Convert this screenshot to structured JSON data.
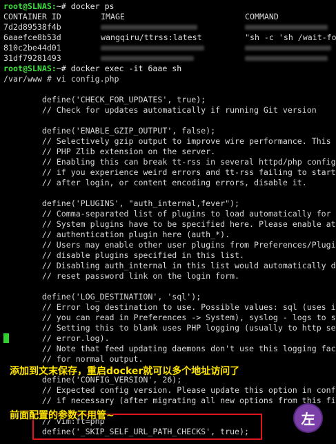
{
  "ps": {
    "prompt": "root@SLNAS:",
    "command": "~# docker ps",
    "headers": {
      "id": "CONTAINER ID",
      "image": "IMAGE",
      "cmd": "COMMAND"
    },
    "rows": [
      {
        "id": "7d2d89538f4b",
        "image": "",
        "cmd": ""
      },
      {
        "id": "6aaefce8b53d",
        "image": "wangqiru/ttrss:latest",
        "cmd": "\"sh -c 'sh /wait-fo"
      },
      {
        "id": "810c2be44d01",
        "image": "",
        "cmd": ""
      },
      {
        "id": "31df79281493",
        "image": "",
        "cmd": ""
      }
    ]
  },
  "exec": {
    "prompt": "root@SLNAS:",
    "command": "~# docker exec -it 6aae sh"
  },
  "vi_line": "/var/www # vi config.php",
  "code": [
    "        define('CHECK_FOR_UPDATES', true);",
    "        // Check for updates automatically if running Git version",
    "",
    "        define('ENABLE_GZIP_OUTPUT', false);",
    "        // Selectively gzip output to improve wire performance. This",
    "        // PHP Zlib extension on the server.",
    "        // Enabling this can break tt-rss in several httpd/php config",
    "        // if you experience weird errors and tt-rss failing to start",
    "        // after login, or content encoding errors, disable it.",
    "",
    "        define('PLUGINS', \"auth_internal,fever\");",
    "        // Comma-separated list of plugins to load automatically for",
    "        // System plugins have to be specified here. Please enable at",
    "        // authentication plugin here (auth_*).",
    "        // Users may enable other user plugins from Preferences/Plugi",
    "        // disable plugins specified in this list.",
    "        // Disabling auth_internal in this list would automatically d",
    "        // reset password link on the login form.",
    "",
    "        define('LOG_DESTINATION', 'sql');",
    "        // Error log destination to use. Possible values: sql (uses i",
    "        // you can read in Preferences -> System), syslog - logs to s",
    "        // Setting this to blank uses PHP logging (usually to http se",
    "        // error.log).",
    "        // Note that feed updating daemons don't use this logging fac",
    "        // for normal output.",
    "",
    "        define('CONFIG_VERSION', 26);",
    "        // Expected config version. Please update this option in conf",
    "        // if necessary (after migrating all new options from this fi",
    "",
    "        // vim:ft=php",
    "        define('_SKIP_SELF_URL_PATH_CHECKS', true);"
  ],
  "annotations": {
    "top": "添加到文末保存，重启docker就可以多个地址访问了",
    "bottom": "前面配置的参数不用管~"
  },
  "logo_glyph": "左",
  "colors": {
    "prompt": "#3fe13f",
    "annotation": "#ffe400",
    "highlight_box": "#e0141e",
    "cursor": "#2fd12f"
  }
}
